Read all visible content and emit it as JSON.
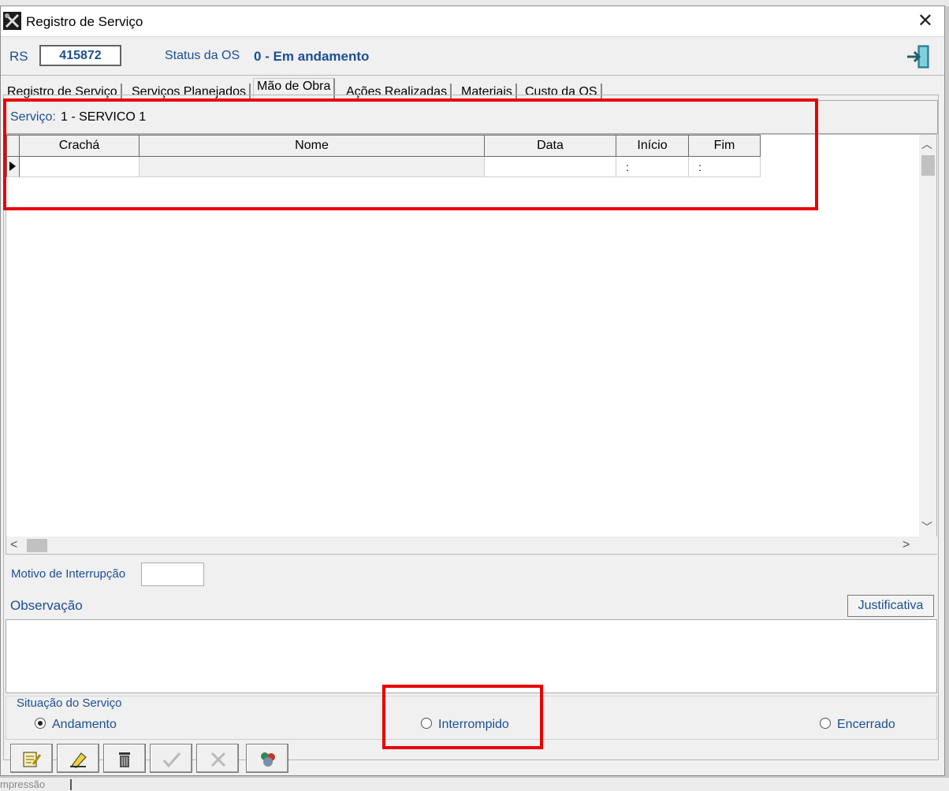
{
  "window": {
    "title": "Registro de Serviço"
  },
  "header": {
    "rs_label": "RS",
    "rs_value": "415872",
    "status_label": "Status da OS",
    "status_value": "0 - Em andamento"
  },
  "tabs": [
    {
      "label": "Registro de Serviço"
    },
    {
      "label": "Serviços Planejados"
    },
    {
      "label": "Mão de Obra"
    },
    {
      "label": "Ações Realizadas"
    },
    {
      "label": "Materiais"
    },
    {
      "label": "Custo da OS"
    }
  ],
  "active_tab": "Mão de Obra",
  "service": {
    "label": "Serviço:",
    "value": "1 - SERVICO 1"
  },
  "grid": {
    "columns": [
      "Crachá",
      "Nome",
      "Data",
      "Início",
      "Fim"
    ],
    "rows": [
      {
        "cracha": "",
        "nome": "",
        "data": "",
        "inicio": ":",
        "fim": ":"
      }
    ]
  },
  "motivo": {
    "label": "Motivo de Interrupção",
    "value": ""
  },
  "observacao": {
    "label": "Observação",
    "justificativa_label": "Justificativa",
    "value": ""
  },
  "situacao": {
    "label": "Situação do Serviço",
    "options": [
      "Andamento",
      "Interrompido",
      "Encerrado"
    ],
    "selected": "Andamento"
  },
  "background": {
    "status_text": "mpressão"
  },
  "toolbar": {
    "buttons": [
      {
        "icon": "edit-note-icon",
        "enabled": true
      },
      {
        "icon": "edit-pencil-icon",
        "enabled": true
      },
      {
        "icon": "trash-icon",
        "enabled": true
      },
      {
        "icon": "check-icon",
        "enabled": false
      },
      {
        "icon": "cancel-x-icon",
        "enabled": false
      },
      {
        "icon": "people-group-icon",
        "enabled": true
      }
    ]
  },
  "colors": {
    "label_blue": "#1b4e95",
    "highlight_red": "#e80000"
  }
}
